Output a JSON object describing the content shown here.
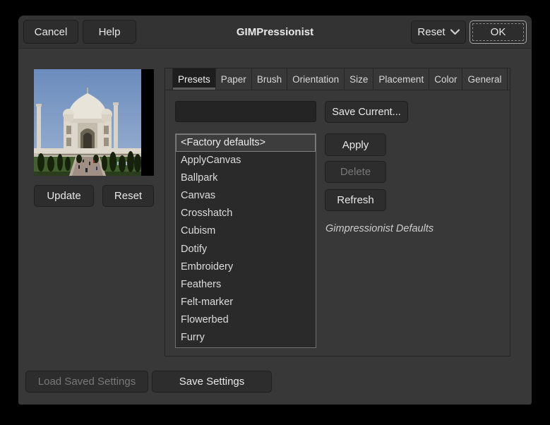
{
  "window": {
    "title": "GIMPressionist"
  },
  "header": {
    "cancel_label": "Cancel",
    "help_label": "Help",
    "reset_label": "Reset",
    "ok_label": "OK"
  },
  "preview": {
    "image_description": "Taj Mahal photograph preview",
    "update_label": "Update",
    "reset_label": "Reset"
  },
  "notebook": {
    "tabs": [
      "Presets",
      "Paper",
      "Brush",
      "Orientation",
      "Size",
      "Placement",
      "Color",
      "General"
    ],
    "active_tab": "Presets"
  },
  "presets": {
    "entry_value": "",
    "save_current_label": "Save Current...",
    "apply_label": "Apply",
    "delete_label": "Delete",
    "refresh_label": "Refresh",
    "selected_item": "<Factory defaults>",
    "description": "Gimpressionist Defaults",
    "list": [
      "<Factory defaults>",
      "ApplyCanvas",
      "Ballpark",
      "Canvas",
      "Crosshatch",
      "Cubism",
      "Dotify",
      "Embroidery",
      "Feathers",
      "Felt-marker",
      "Flowerbed",
      "Furry"
    ]
  },
  "footer": {
    "load_saved_label": "Load Saved Settings",
    "save_settings_label": "Save Settings"
  },
  "colors": {
    "dialog_bg": "#383838",
    "header_bg": "#333333",
    "button_bg": "#2d2d2d",
    "list_bg": "#2a2a2a",
    "entry_bg": "#242424",
    "selected_row_bg": "#3d3d3d",
    "selected_row_border": "#808080",
    "tab_active_bg": "#1e1e1e",
    "disabled_text": "#787878"
  }
}
